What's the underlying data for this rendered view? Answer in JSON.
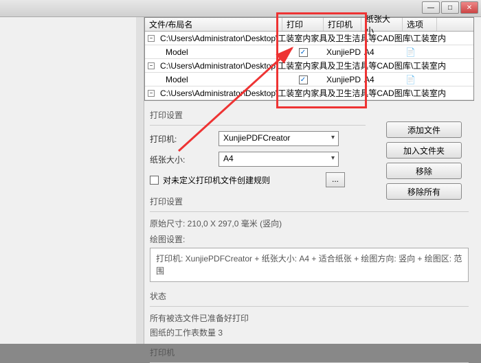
{
  "titlebar": {
    "min": "—",
    "max": "□",
    "close": "✕"
  },
  "table": {
    "headers": {
      "name": "文件/布局名",
      "print": "打印",
      "printer": "打印机",
      "paper": "纸张大小",
      "options": "选项"
    },
    "groups": [
      {
        "path": "C:\\Users\\Administrator\\Desktop\\工装室内家具及卫生洁具等CAD图库\\工装室内"
      },
      {
        "path": "C:\\Users\\Administrator\\Desktop\\工装室内家具及卫生洁具等CAD图库\\工装室内"
      },
      {
        "path": "C:\\Users\\Administrator\\Desktop\\工装室内家具及卫生洁具等CAD图库\\工装室内"
      }
    ],
    "model": {
      "name": "Model",
      "printer": "XunjiePDF",
      "paper": "A4"
    }
  },
  "print_settings": {
    "title": "打印设置",
    "printer_label": "打印机:",
    "printer_value": "XunjiePDFCreator",
    "paper_label": "纸张大小:",
    "paper_value": "A4",
    "undef_rule": "对未定义打印机文件创建规则",
    "dots": "..."
  },
  "buttons": {
    "add_file": "添加文件",
    "add_folder": "加入文件夹",
    "remove": "移除",
    "remove_all": "移除所有"
  },
  "info": {
    "title": "打印设置",
    "orig_size": "原始尺寸: 210,0 X 297,0 毫米 (竖向)",
    "draw_label": "绘图设置:",
    "draw_value": "打印机: XunjiePDFCreator + 纸张大小: A4 + 适合纸张 + 绘图方向: 竖向 + 绘图区: 范围"
  },
  "status": {
    "title": "状态",
    "ready": "所有被选文件已准备好打印",
    "sheets": "图纸的工作表数量 3"
  },
  "footer": {
    "title": "打印机"
  }
}
